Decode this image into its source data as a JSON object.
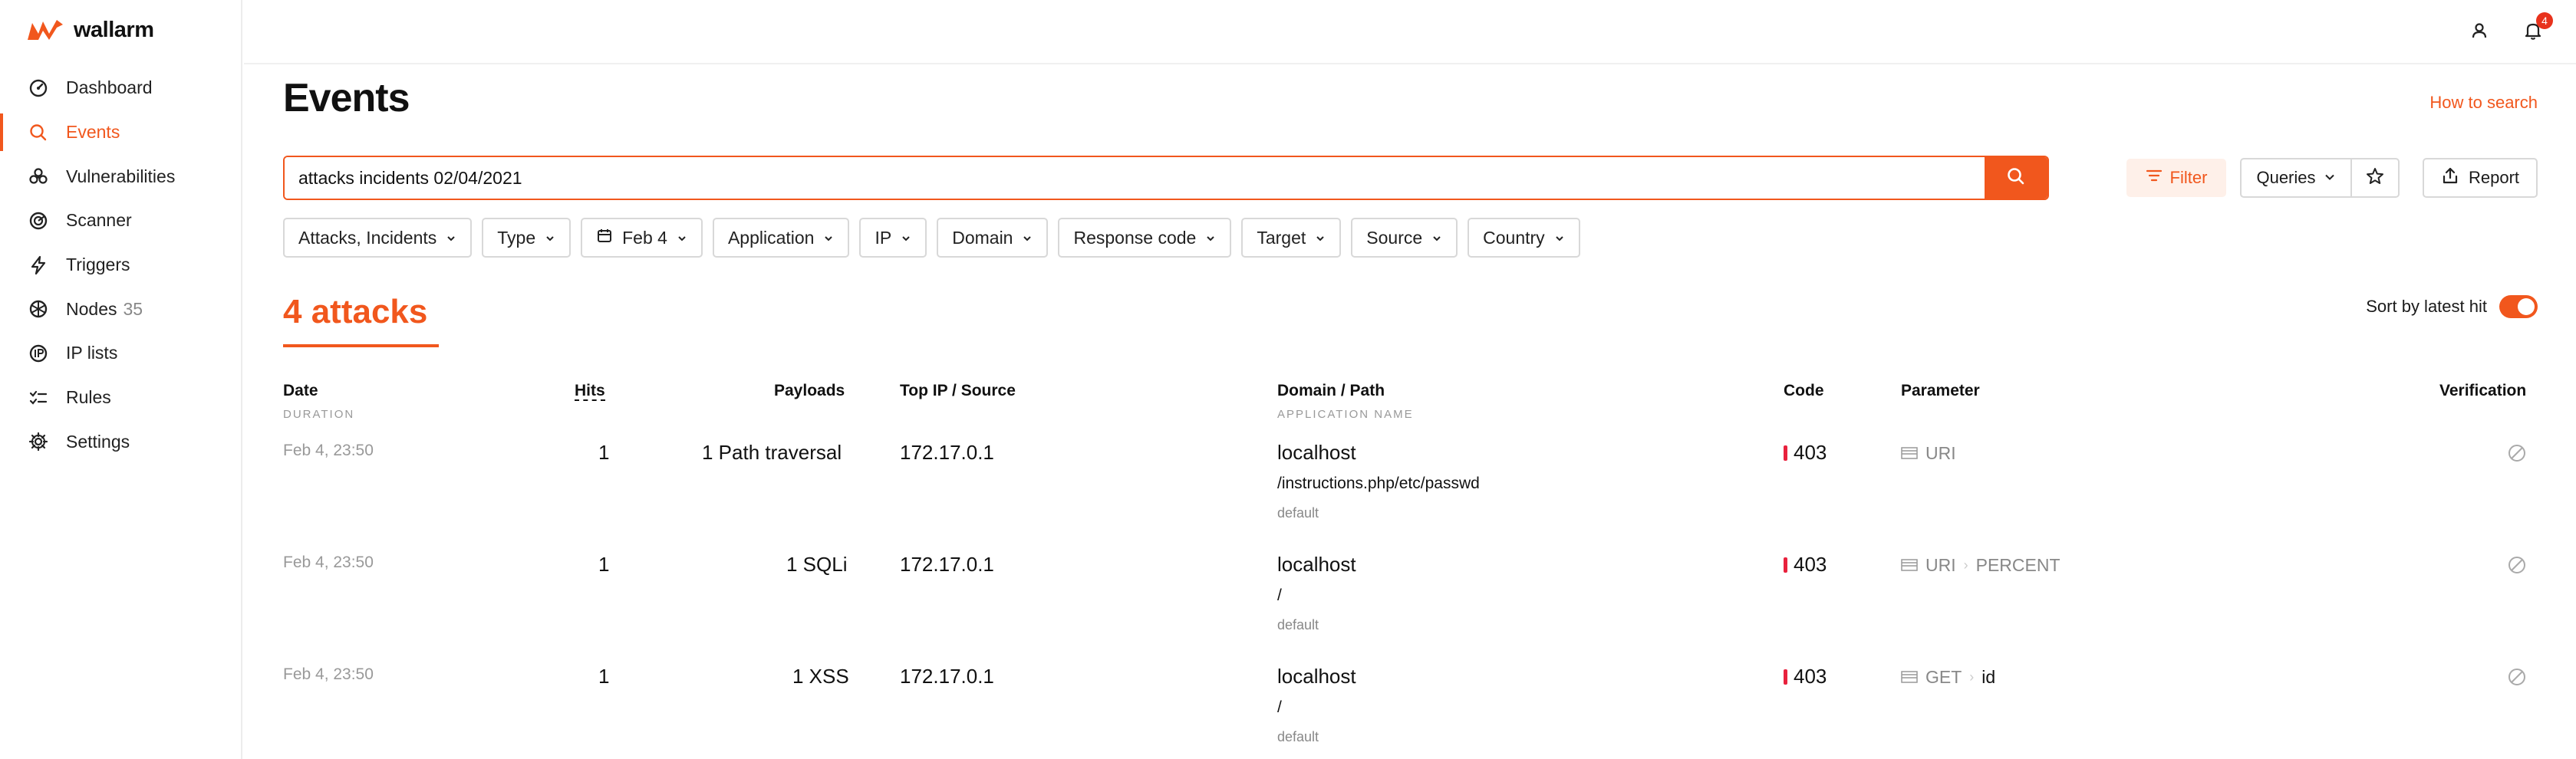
{
  "brand": {
    "name": "wallarm",
    "accent": "#f1571d"
  },
  "sidebar": {
    "items": [
      {
        "label": "Dashboard",
        "icon": "dashboard-icon",
        "active": false,
        "count": ""
      },
      {
        "label": "Events",
        "icon": "search-icon",
        "active": true,
        "count": ""
      },
      {
        "label": "Vulnerabilities",
        "icon": "biohazard-icon",
        "active": false,
        "count": ""
      },
      {
        "label": "Scanner",
        "icon": "radar-icon",
        "active": false,
        "count": ""
      },
      {
        "label": "Triggers",
        "icon": "lightning-icon",
        "active": false,
        "count": ""
      },
      {
        "label": "Nodes",
        "icon": "nodes-icon",
        "active": false,
        "count": "35"
      },
      {
        "label": "IP lists",
        "icon": "ip-icon",
        "active": false,
        "count": ""
      },
      {
        "label": "Rules",
        "icon": "rules-icon",
        "active": false,
        "count": ""
      },
      {
        "label": "Settings",
        "icon": "gear-icon",
        "active": false,
        "count": ""
      }
    ]
  },
  "topbar": {
    "notifications_count": "4"
  },
  "page": {
    "title": "Events",
    "help_link": "How to search"
  },
  "search": {
    "value": "attacks incidents 02/04/2021"
  },
  "toolbar": {
    "filter_label": "Filter",
    "queries_label": "Queries",
    "report_label": "Report"
  },
  "chips": [
    "Attacks, Incidents",
    "Type",
    "Feb 4",
    "Application",
    "IP",
    "Domain",
    "Response code",
    "Target",
    "Source",
    "Country"
  ],
  "results": {
    "count_label": "4 attacks",
    "sort_label": "Sort by latest hit",
    "sort_enabled": true
  },
  "table": {
    "headers": {
      "date": "Date",
      "date_sub": "DURATION",
      "hits": "Hits",
      "payloads": "Payloads",
      "source": "Top IP / Source",
      "domain": "Domain / Path",
      "domain_sub": "APPLICATION NAME",
      "code": "Code",
      "parameter": "Parameter",
      "verification": "Verification"
    },
    "rows": [
      {
        "date": "Feb 4, 23:50",
        "hits": "1",
        "payload": "1 Path traversal",
        "ip": "172.17.0.1",
        "domain": "localhost",
        "path": "/instructions.php/etc/passwd",
        "app": "default",
        "code": "403",
        "param": [
          "URI"
        ]
      },
      {
        "date": "Feb 4, 23:50",
        "hits": "1",
        "payload": "1 SQLi",
        "ip": "172.17.0.1",
        "domain": "localhost",
        "path": "/",
        "app": "default",
        "code": "403",
        "param": [
          "URI",
          "PERCENT"
        ]
      },
      {
        "date": "Feb 4, 23:50",
        "hits": "1",
        "payload": "1 XSS",
        "ip": "172.17.0.1",
        "domain": "localhost",
        "path": "/",
        "app": "default",
        "code": "403",
        "param": [
          "GET",
          "id"
        ]
      }
    ]
  }
}
